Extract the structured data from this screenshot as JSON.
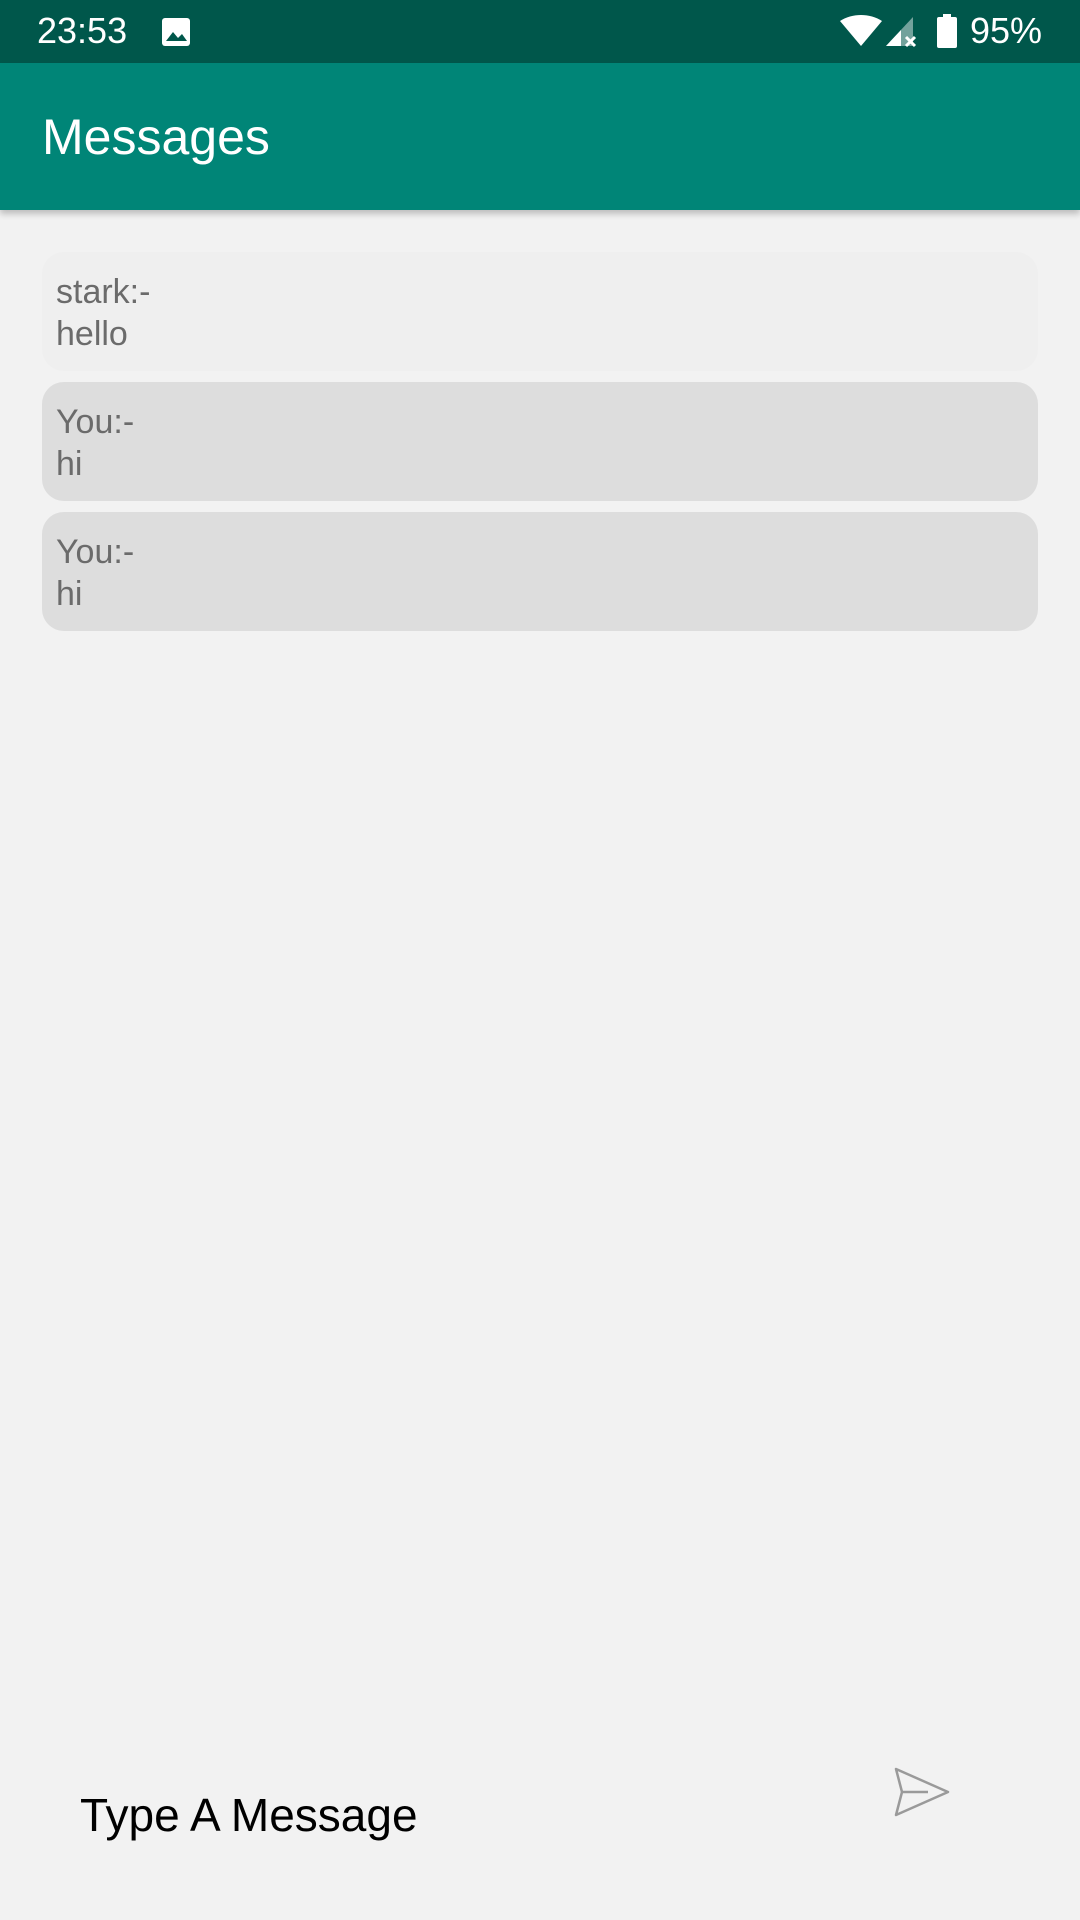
{
  "status_bar": {
    "time": "23:53",
    "battery": "95%",
    "icons": [
      "image-icon",
      "wifi-icon",
      "signal-no-data-icon",
      "battery-icon"
    ],
    "background": "#00574b"
  },
  "app_bar": {
    "title": "Messages",
    "background": "#008577"
  },
  "messages": [
    {
      "sender": "stark:-",
      "text": "hello",
      "type": "incoming"
    },
    {
      "sender": "You:-",
      "text": "hi",
      "type": "outgoing"
    },
    {
      "sender": "You:-",
      "text": "hi",
      "type": "outgoing"
    }
  ],
  "composer": {
    "placeholder": "Type A Message",
    "send_icon": "send-icon"
  },
  "colors": {
    "background": "#f2f2f2",
    "incoming_bubble": "#efefef",
    "outgoing_bubble": "#dddddd",
    "message_text": "#6b6b6b"
  }
}
